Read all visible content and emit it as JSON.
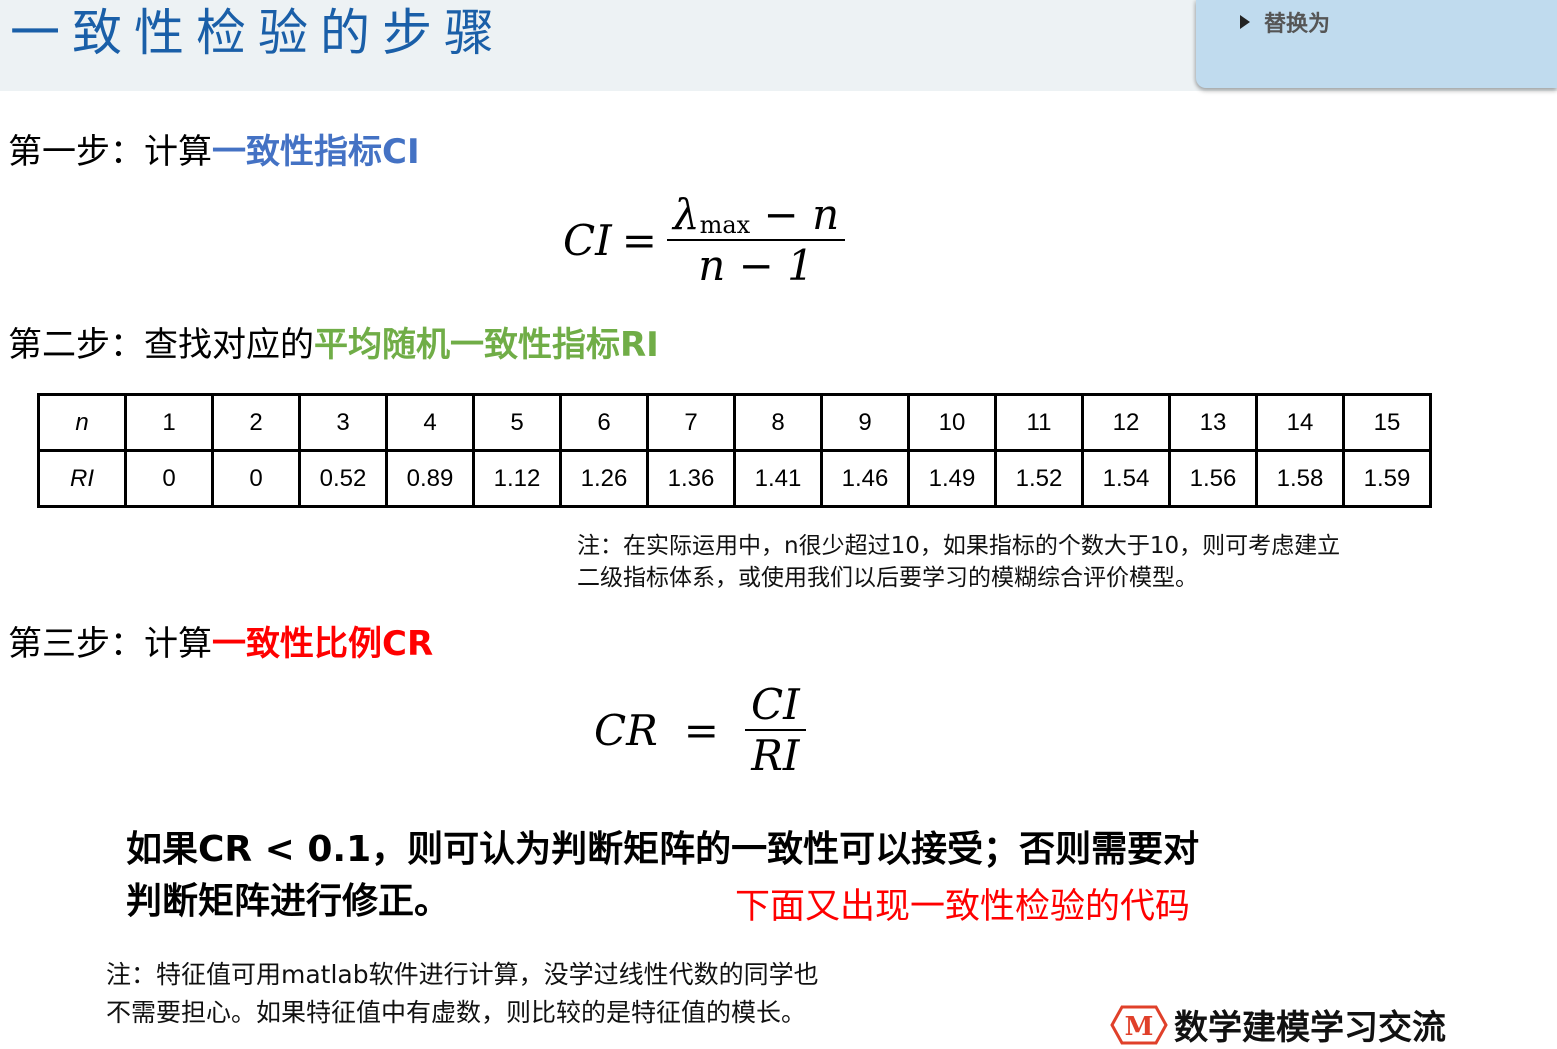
{
  "header": {
    "title": "一致性检验的步骤",
    "replace_panel": {
      "item_label": "替换为",
      "icon": "triangle-right-icon"
    }
  },
  "step1": {
    "prefix": "第一步：计算",
    "highlight": "一致性指标CI",
    "highlight_color": "#4472c4"
  },
  "formula_ci": {
    "lhs": "CI",
    "eq": "=",
    "numerator_symbol": "λ",
    "numerator_sub": "max",
    "numerator_rest": " − n",
    "denominator": "n − 1"
  },
  "step2": {
    "prefix": "第二步：查找对应的",
    "highlight": "平均随机一致性指标RI",
    "highlight_color": "#70ad47"
  },
  "ri_table": {
    "row_headers": [
      "n",
      "RI"
    ],
    "n": [
      "1",
      "2",
      "3",
      "4",
      "5",
      "6",
      "7",
      "8",
      "9",
      "10",
      "11",
      "12",
      "13",
      "14",
      "15"
    ],
    "ri": [
      "0",
      "0",
      "0.52",
      "0.89",
      "1.12",
      "1.26",
      "1.36",
      "1.41",
      "1.46",
      "1.49",
      "1.52",
      "1.54",
      "1.56",
      "1.58",
      "1.59"
    ]
  },
  "note1": {
    "line1": "注：在实际运用中，n很少超过10，如果指标的个数大于10，则可考虑建立",
    "line2": "二级指标体系，或使用我们以后要学习的模糊综合评价模型。"
  },
  "step3": {
    "prefix": "第三步：计算",
    "highlight": "一致性比例CR",
    "highlight_color": "#ff0000"
  },
  "formula_cr": {
    "lhs": "CR",
    "eq": "=",
    "numerator": "CI",
    "denominator": "RI"
  },
  "conclusion": {
    "line1": "如果CR < 0.1，则可认为判断矩阵的一致性可以接受；否则需要对",
    "line2": "判断矩阵进行修正。"
  },
  "code_hint": "下面又出现一致性检验的代码",
  "note2": {
    "line1": "注：特征值可用matlab软件进行计算，没学过线性代数的同学也",
    "line2": "不需要担心。如果特征值中有虚数，则比较的是特征值的模长。"
  },
  "watermark": {
    "logo_letter": "M",
    "text": "数学建模学习交流",
    "logo_color": "#e0402a"
  }
}
